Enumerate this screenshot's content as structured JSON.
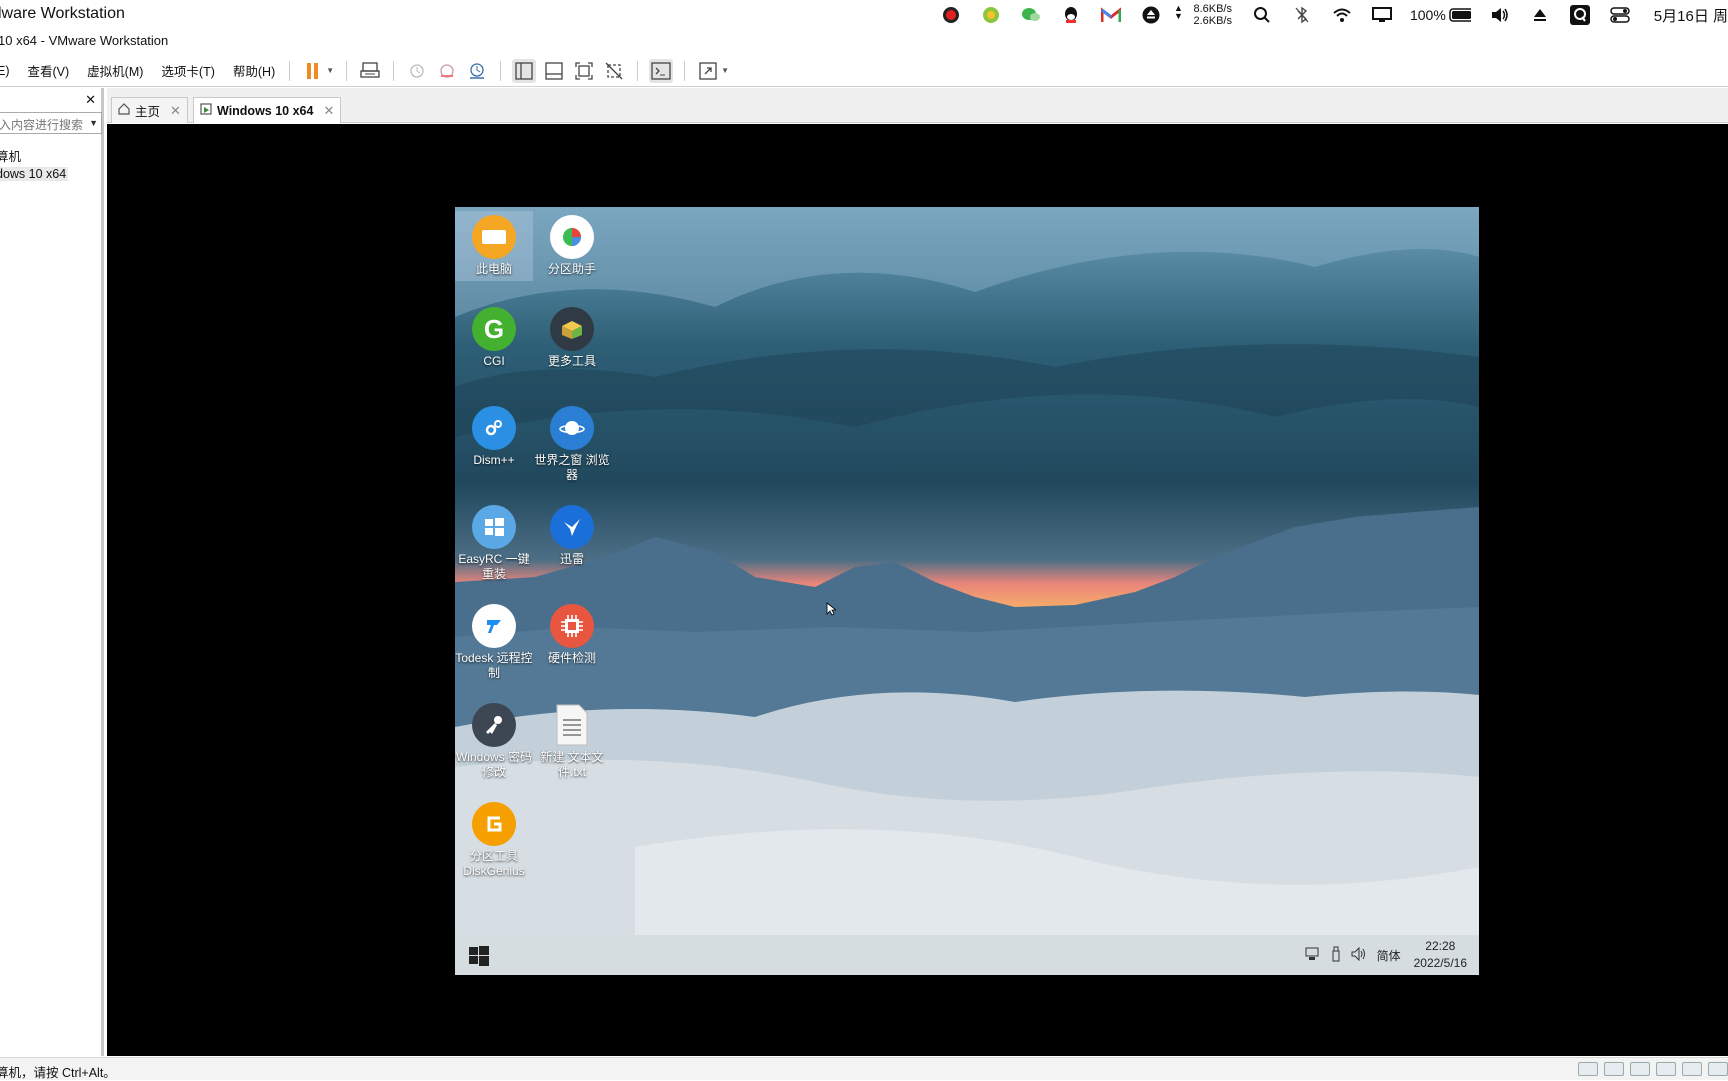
{
  "menubar": {
    "app_title": "lware Workstation",
    "net_speed_up": "8.6KB/s",
    "net_speed_down": "2.6KB/s",
    "battery": "100%",
    "clock": "5月16日 周"
  },
  "window": {
    "title": "10 x64 - VMware Workstation"
  },
  "vm_menu": {
    "items": [
      "E)",
      "查看(V)",
      "虚拟机(M)",
      "选项卡(T)",
      "帮助(H)"
    ]
  },
  "sidebar": {
    "search_placeholder": "入内容进行搜索",
    "tree": [
      "算机",
      "dows 10 x64"
    ]
  },
  "tabs": [
    {
      "label": "主页"
    },
    {
      "label": "Windows 10 x64"
    }
  ],
  "guest": {
    "icons": [
      {
        "label": "此电脑"
      },
      {
        "label": "分区助手"
      },
      {
        "label": "CGI"
      },
      {
        "label": "更多工具"
      },
      {
        "label": "Dism++"
      },
      {
        "label": "世界之窗 浏览器"
      },
      {
        "label": "EasyRC 一键重装"
      },
      {
        "label": "迅雷"
      },
      {
        "label": "Todesk 远程控制"
      },
      {
        "label": "硬件检测"
      },
      {
        "label": "Windows 密码修改"
      },
      {
        "label": "新建 文本文件.txt"
      },
      {
        "label": "分区工具 DiskGenius"
      }
    ],
    "taskbar": {
      "ime": "简体",
      "time": "22:28",
      "date": "2022/5/16"
    }
  },
  "status": {
    "text": "算机，请按 Ctrl+Alt。"
  },
  "colors": {
    "vm_background": "#000000",
    "pause_orange": "#f08a24"
  }
}
